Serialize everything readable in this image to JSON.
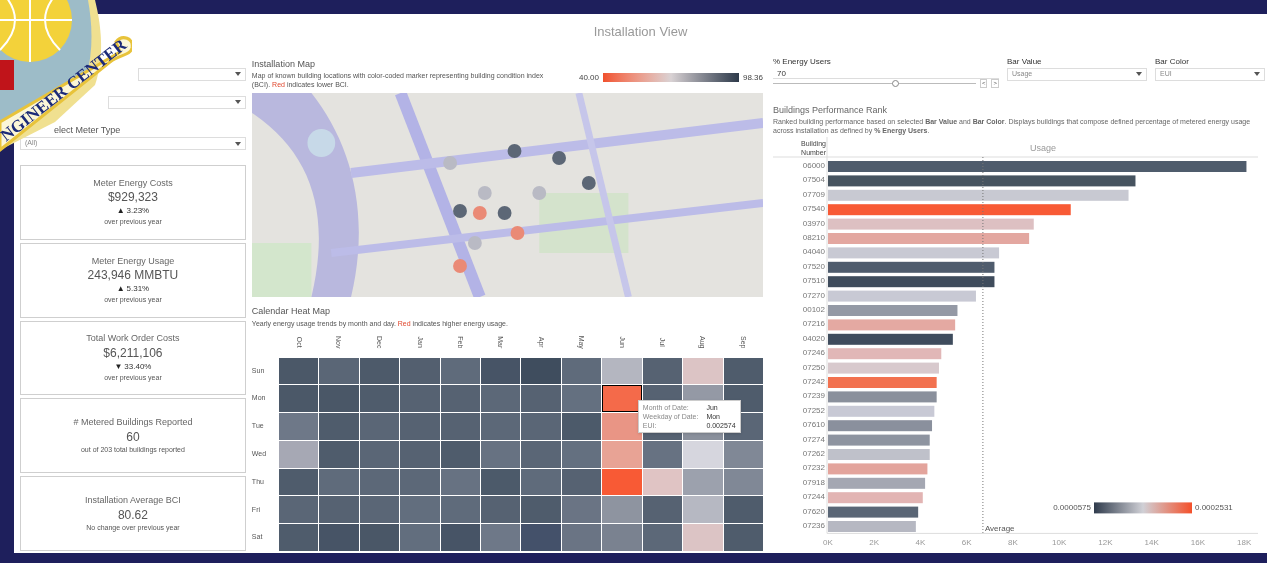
{
  "logo": {
    "text": "NGINEER CENTER"
  },
  "title": "Installation View",
  "filters": [
    {
      "kind": "dropdown"
    },
    {
      "kind": "dropdown"
    },
    {
      "kind": "dropdown",
      "label": "elect Meter Type",
      "value": "(All)"
    }
  ],
  "kpis": [
    {
      "title": "Meter Energy Costs",
      "value": "$929,323",
      "change": {
        "arrow": "▲",
        "text": "3.23%"
      },
      "note": "over previous year"
    },
    {
      "title": "Meter Energy Usage",
      "value": "243,946 MMBTU",
      "change": {
        "arrow": "▲",
        "text": "5.31%"
      },
      "note": "over previous year"
    },
    {
      "title": "Total Work Order Costs",
      "value": "$6,211,106",
      "change": {
        "arrow": "▼",
        "text": "33.40%"
      },
      "note": "over previous year"
    },
    {
      "title": "# Metered Buildings Reported",
      "value": "60",
      "note": "out of 203 total buildings reported"
    },
    {
      "title": "Installation Average BCI",
      "value": "80.62",
      "note": "No change over previous year"
    }
  ],
  "map": {
    "title": "Installation Map",
    "description": [
      "Map of known building locations with color-coded marker representing building condition index (BCI). ",
      "Red",
      " indicates lower BCI."
    ],
    "legend": {
      "min": "40.00",
      "max": "98.36"
    }
  },
  "heatmap": {
    "title": "Calendar Heat Map",
    "description": [
      "Yearly energy usage trends by month and day. ",
      "Red",
      " indicates higher energy usage."
    ],
    "months": [
      "Oct",
      "Nov",
      "Dec",
      "Jan",
      "Feb",
      "Mar",
      "Apr",
      "May",
      "Jun",
      "Jul",
      "Aug",
      "Sep"
    ],
    "rows": [
      {
        "day": "Sun",
        "cells": [
          {
            "color": "#4b5868",
            "selected": false
          },
          {
            "color": "#5a6676",
            "selected": false
          },
          {
            "color": "#4d5a6a",
            "selected": false
          },
          {
            "color": "#535f6f",
            "selected": false
          },
          {
            "color": "#5f6b7b",
            "selected": false
          },
          {
            "color": "#475466",
            "selected": false
          },
          {
            "color": "#3f4d5e",
            "selected": false
          },
          {
            "color": "#5f6b7b",
            "selected": false
          },
          {
            "color": "#b4b6c0",
            "selected": false
          },
          {
            "color": "#566272",
            "selected": false
          },
          {
            "color": "#dcc4c5",
            "selected": false
          },
          {
            "color": "#4f5c6c",
            "selected": false
          }
        ]
      },
      {
        "day": "Mon",
        "cells": [
          {
            "color": "#4b5868",
            "selected": false
          },
          {
            "color": "#4a5767",
            "selected": false
          },
          {
            "color": "#4f5c6c",
            "selected": false
          },
          {
            "color": "#566272",
            "selected": false
          },
          {
            "color": "#566272",
            "selected": false
          },
          {
            "color": "#5c6878",
            "selected": false
          },
          {
            "color": "#566272",
            "selected": false
          },
          {
            "color": "#647080",
            "selected": false
          },
          {
            "color": "#f46a4a",
            "selected": true
          },
          {
            "color": "#566272",
            "selected": false
          },
          {
            "color": "#9499a5",
            "selected": false
          },
          {
            "color": "#4f5c6c",
            "selected": false
          }
        ]
      },
      {
        "day": "Tue",
        "cells": [
          {
            "color": "#6e7888",
            "selected": false
          },
          {
            "color": "#4f5c6c",
            "selected": false
          },
          {
            "color": "#5a6676",
            "selected": false
          },
          {
            "color": "#566272",
            "selected": false
          },
          {
            "color": "#566272",
            "selected": false
          },
          {
            "color": "#5c6878",
            "selected": false
          },
          {
            "color": "#5a6676",
            "selected": false
          },
          {
            "color": "#4c5a6a",
            "selected": false
          },
          {
            "color": "#e99585",
            "selected": false
          },
          {
            "color": "#566272",
            "selected": false
          },
          {
            "color": "#8a909c",
            "selected": false
          },
          {
            "color": "#5a6676",
            "selected": false
          }
        ]
      },
      {
        "day": "Wed",
        "cells": [
          {
            "color": "#a6a8b4",
            "selected": false
          },
          {
            "color": "#4f5c6c",
            "selected": false
          },
          {
            "color": "#5a6676",
            "selected": false
          },
          {
            "color": "#566272",
            "selected": false
          },
          {
            "color": "#4f5c6c",
            "selected": false
          },
          {
            "color": "#677282",
            "selected": false
          },
          {
            "color": "#5a6676",
            "selected": false
          },
          {
            "color": "#647080",
            "selected": false
          },
          {
            "color": "#e8a395",
            "selected": false
          },
          {
            "color": "#677282",
            "selected": false
          },
          {
            "color": "#d6d6de",
            "selected": false
          },
          {
            "color": "#808896",
            "selected": false
          }
        ]
      },
      {
        "day": "Thu",
        "cells": [
          {
            "color": "#4f5c6c",
            "selected": false
          },
          {
            "color": "#5f6b7b",
            "selected": false
          },
          {
            "color": "#5c6878",
            "selected": false
          },
          {
            "color": "#5c6878",
            "selected": false
          },
          {
            "color": "#677282",
            "selected": false
          },
          {
            "color": "#4c5a6a",
            "selected": false
          },
          {
            "color": "#5f6b7b",
            "selected": false
          },
          {
            "color": "#566272",
            "selected": false
          },
          {
            "color": "#f85a35",
            "selected": false
          },
          {
            "color": "#e0c4c4",
            "selected": false
          },
          {
            "color": "#9ca1ad",
            "selected": false
          },
          {
            "color": "#808896",
            "selected": false
          }
        ]
      },
      {
        "day": "Fri",
        "cells": [
          {
            "color": "#5a6676",
            "selected": false
          },
          {
            "color": "#566272",
            "selected": false
          },
          {
            "color": "#5a6676",
            "selected": false
          },
          {
            "color": "#626e7e",
            "selected": false
          },
          {
            "color": "#5f6b7b",
            "selected": false
          },
          {
            "color": "#566272",
            "selected": false
          },
          {
            "color": "#4f5c6c",
            "selected": false
          },
          {
            "color": "#6a7484",
            "selected": false
          },
          {
            "color": "#8e94a0",
            "selected": false
          },
          {
            "color": "#566272",
            "selected": false
          },
          {
            "color": "#b6b8c2",
            "selected": false
          },
          {
            "color": "#4f5c6c",
            "selected": false
          }
        ]
      },
      {
        "day": "Sat",
        "cells": [
          {
            "color": "#4f5c6c",
            "selected": false
          },
          {
            "color": "#475466",
            "selected": false
          },
          {
            "color": "#4a5767",
            "selected": false
          },
          {
            "color": "#626e7e",
            "selected": false
          },
          {
            "color": "#475466",
            "selected": false
          },
          {
            "color": "#6e7888",
            "selected": false
          },
          {
            "color": "#44516a",
            "selected": false
          },
          {
            "color": "#6a7484",
            "selected": false
          },
          {
            "color": "#7a8290",
            "selected": false
          },
          {
            "color": "#5c6878",
            "selected": false
          },
          {
            "color": "#dcc4c5",
            "selected": false
          },
          {
            "color": "#4f5c6c",
            "selected": false
          }
        ]
      }
    ],
    "tooltip": [
      {
        "label": "Month of Date:",
        "value": "Jun"
      },
      {
        "label": "Weekday of Date:",
        "value": "Mon"
      },
      {
        "label": "EUI:",
        "value": "0.002574"
      }
    ]
  },
  "controls": {
    "energy_users": {
      "label": "% Energy Users",
      "value": "70",
      "level": 0.6,
      "step_buttons": [
        "<",
        ">"
      ]
    },
    "bar_value": {
      "label": "Bar Value",
      "value": "Usage"
    },
    "bar_color": {
      "label": "Bar Color",
      "value": "EUI"
    }
  },
  "ranking": {
    "title": "Buildings Performance Rank",
    "description": "Ranked building performance based on selected **Bar Value** and **Bar Color**. Displays buildings that compose defined percentage of metered energy usage across installation as defined by **% Energy Users**.",
    "row_header": "Building Number",
    "color_legend": {
      "min": "0.0000575",
      "max": "0.0002531"
    },
    "bars": [
      {
        "color": "#4f5c6c"
      },
      {
        "color": "#46535f"
      },
      {
        "color": "#c8c9d2"
      },
      {
        "color": "#f85a35"
      },
      {
        "color": "#ddc0c2"
      },
      {
        "color": "#e3a7a0"
      },
      {
        "color": "#c8c9d3"
      },
      {
        "color": "#4f5c6d"
      },
      {
        "color": "#3f4c5c"
      },
      {
        "color": "#c8c9d4"
      },
      {
        "color": "#9499a5"
      },
      {
        "color": "#e4a9a2"
      },
      {
        "color": "#3f4c5d"
      },
      {
        "color": "#e1b7b7"
      },
      {
        "color": "#d8c9cd"
      },
      {
        "color": "#f2714f"
      },
      {
        "color": "#8a909c"
      },
      {
        "color": "#c8c9d5"
      },
      {
        "color": "#8a909d"
      },
      {
        "color": "#8e94a0"
      },
      {
        "color": "#bfc1ca"
      },
      {
        "color": "#e3a49c"
      },
      {
        "color": "#a4a7b2"
      },
      {
        "color": "#e2b4b3"
      },
      {
        "color": "#5a6676"
      },
      {
        "color": "#b6b8c2"
      }
    ],
    "chart_data": {
      "type": "bar",
      "orientation": "horizontal",
      "categories": [
        "06000",
        "07504",
        "07709",
        "07540",
        "03970",
        "08210",
        "04040",
        "07520",
        "07510",
        "07270",
        "00102",
        "07216",
        "04020",
        "07246",
        "07250",
        "07242",
        "07239",
        "07252",
        "07610",
        "07274",
        "07262",
        "07232",
        "07918",
        "07244",
        "07620",
        "07236"
      ],
      "series": [
        {
          "name": "Usage",
          "values": [
            18.1,
            13.3,
            13.0,
            10.5,
            8.9,
            8.7,
            7.4,
            7.2,
            7.2,
            6.4,
            5.6,
            5.5,
            5.4,
            4.9,
            4.8,
            4.7,
            4.7,
            4.6,
            4.5,
            4.4,
            4.4,
            4.3,
            4.2,
            4.1,
            3.9,
            3.8
          ]
        }
      ],
      "xlim": [
        0,
        18.6
      ],
      "xticks": [
        {
          "value": 0,
          "label": "0K"
        },
        {
          "value": 2,
          "label": "2K"
        },
        {
          "value": 4,
          "label": "4K"
        },
        {
          "value": 6,
          "label": "6K"
        },
        {
          "value": 8,
          "label": "8K"
        },
        {
          "value": 10,
          "label": "10K"
        },
        {
          "value": 12,
          "label": "12K"
        },
        {
          "value": 14,
          "label": "14K"
        },
        {
          "value": 16,
          "label": "16K"
        },
        {
          "value": 18,
          "label": "18K"
        }
      ],
      "ref_lines": [
        {
          "axis": "x",
          "value": 6.7,
          "label": "Average"
        }
      ]
    }
  }
}
